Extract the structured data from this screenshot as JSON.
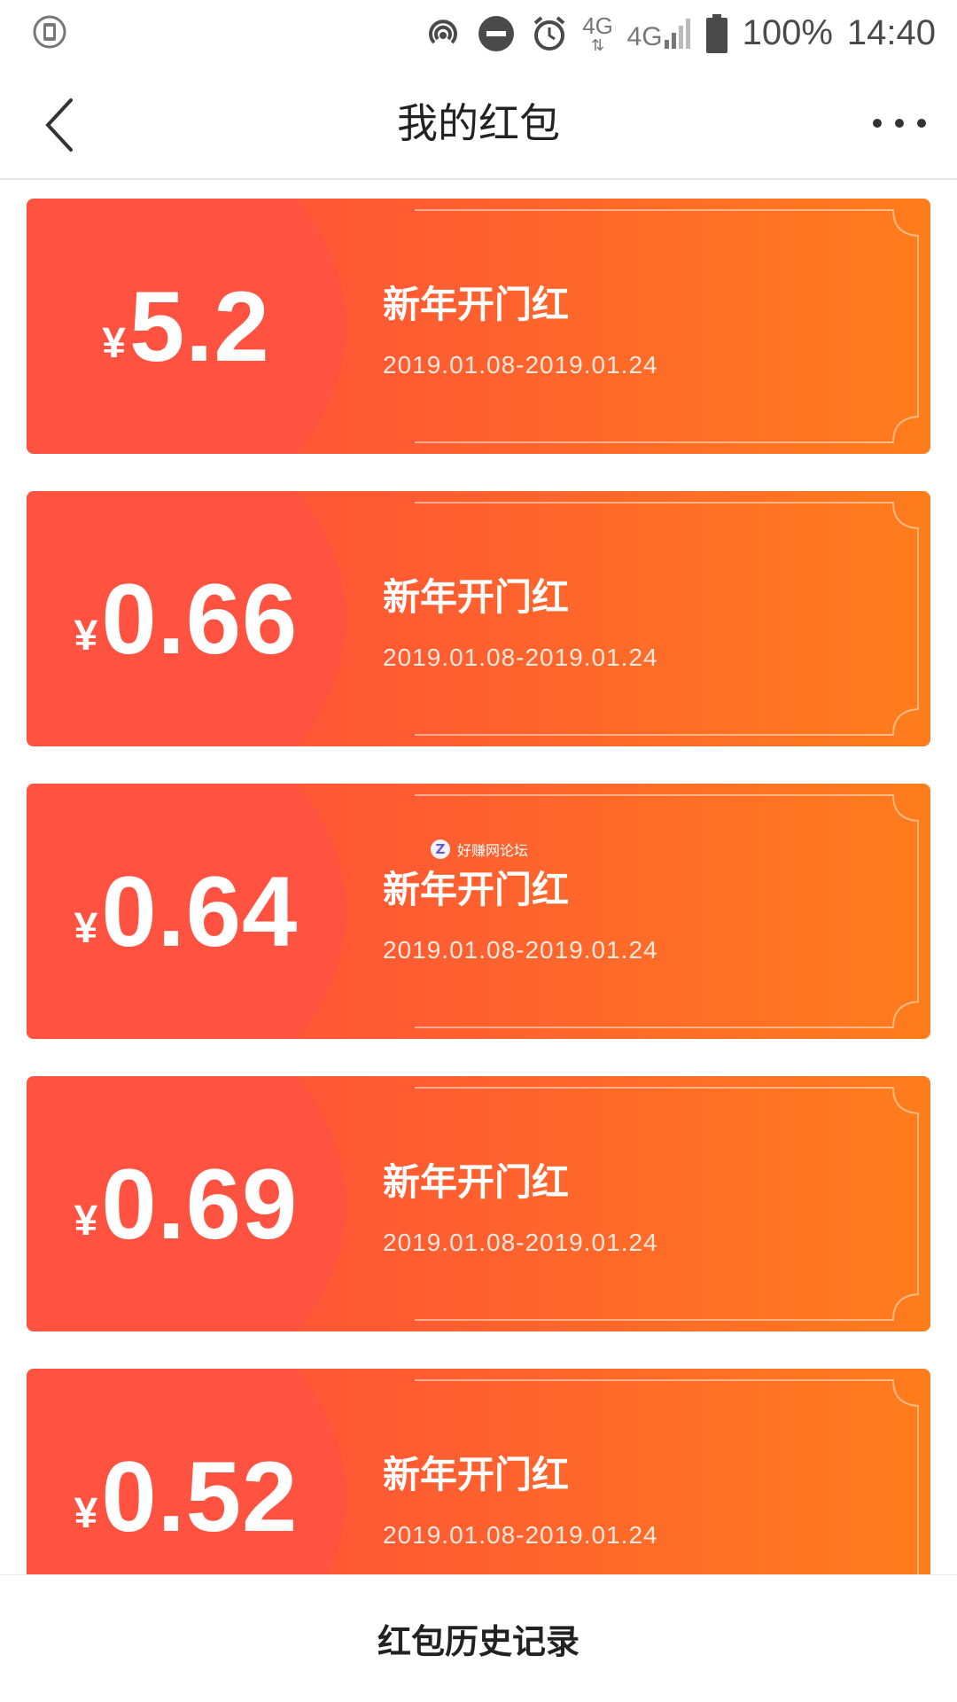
{
  "status_bar": {
    "left_icon": "sim-icon",
    "icons": [
      "hotspot-icon",
      "do-not-disturb-icon",
      "alarm-icon"
    ],
    "network_small": "4G",
    "network_main": "4G",
    "battery": "100%",
    "time": "14:40"
  },
  "nav": {
    "title": "我的红包",
    "back_icon": "chevron-left-icon",
    "more_icon": "more-horizontal-icon"
  },
  "watermark": {
    "badge": "Z",
    "text": "好赚网论坛"
  },
  "cards": [
    {
      "currency": "¥",
      "amount": "5.2",
      "title": "新年开门红",
      "date": "2019.01.08-2019.01.24"
    },
    {
      "currency": "¥",
      "amount": "0.66",
      "title": "新年开门红",
      "date": "2019.01.08-2019.01.24"
    },
    {
      "currency": "¥",
      "amount": "0.64",
      "title": "新年开门红",
      "date": "2019.01.08-2019.01.24"
    },
    {
      "currency": "¥",
      "amount": "0.69",
      "title": "新年开门红",
      "date": "2019.01.08-2019.01.24"
    },
    {
      "currency": "¥",
      "amount": "0.52",
      "title": "新年开门红",
      "date": "2019.01.08-2019.01.24"
    }
  ],
  "bottom": {
    "label": "红包历史记录"
  },
  "colors": {
    "card_start": "#ff4c3b",
    "card_end": "#ff7d1c",
    "card_left": "#ff5241"
  }
}
